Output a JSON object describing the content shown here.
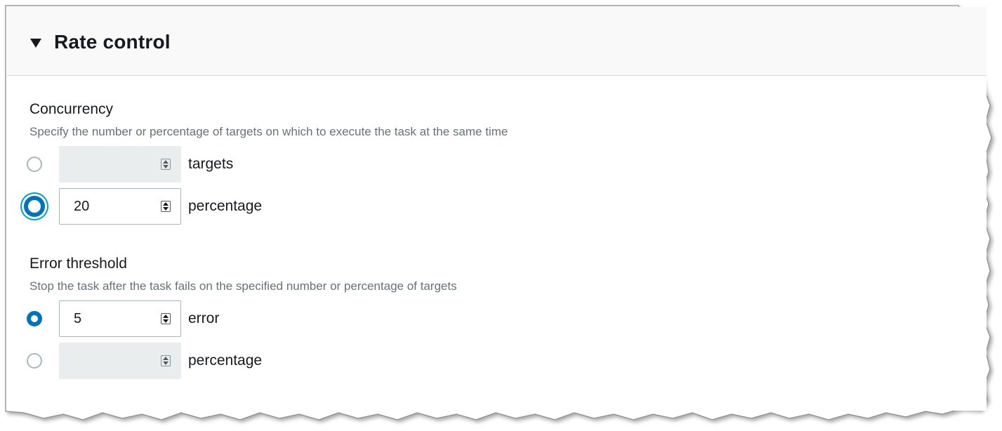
{
  "panel": {
    "title": "Rate control",
    "expanded": true
  },
  "concurrency": {
    "label": "Concurrency",
    "description": "Specify the number or percentage of targets on which to execute the task at the same time",
    "options": [
      {
        "value": "",
        "unit": "targets",
        "selected": false
      },
      {
        "value": "20",
        "unit": "percentage",
        "selected": true
      }
    ]
  },
  "error_threshold": {
    "label": "Error threshold",
    "description": "Stop the task after the task fails on the specified number or percentage of targets",
    "options": [
      {
        "value": "5",
        "unit": "error",
        "selected": true
      },
      {
        "value": "",
        "unit": "percentage",
        "selected": false
      }
    ]
  },
  "colors": {
    "accent": "#0073bb",
    "focus_ring": "#00a1c9",
    "header_bg": "#f9f9f9",
    "disabled_input_bg": "#eaeded",
    "muted_text": "#687078"
  },
  "icons": {
    "toggle": "caret-down-icon",
    "stepper": "spinner-icon"
  }
}
